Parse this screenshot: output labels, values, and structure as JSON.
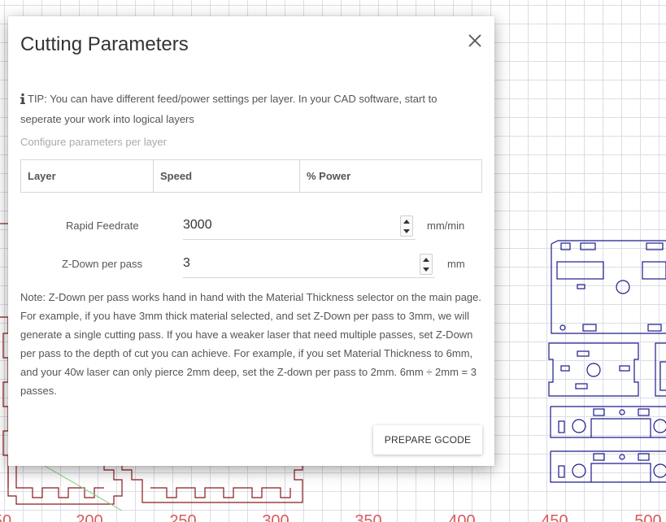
{
  "canvas": {
    "axis_labels": [
      "50",
      "200",
      "250",
      "300",
      "350",
      "400",
      "450",
      "500"
    ],
    "grid_color": "#dcdde6",
    "axis_label_color": "#d95b5b",
    "part_outline_red": "#8b1a1a",
    "part_outline_blue": "#1c1c8c"
  },
  "modal": {
    "title": "Cutting Parameters",
    "close_icon": "close-icon",
    "tip_icon": "info-icon",
    "tip_text": "TIP: You can have different feed/power settings per layer. In your CAD software, start to seperate your work into logical layers",
    "configure_text": "Configure parameters per layer",
    "table_headers": [
      "Layer",
      "Speed",
      "% Power"
    ],
    "rapid_feedrate": {
      "label": "Rapid Feedrate",
      "value": "3000",
      "unit": "mm/min"
    },
    "zdown": {
      "label": "Z-Down per pass",
      "value": "3",
      "unit": "mm"
    },
    "note": "Note: Z-Down per pass works hand in hand with the Material Thickness selector on the main page. For example, if you have 3mm thick material selected, and set Z-Down per pass to 3mm, we will generate a single cutting pass. If you have a weaker laser that need multiple passes, set Z-Down per pass to the depth of cut you can achieve. For example, if you set Material Thickness to 6mm, and your 40w laser can only pierce 2mm deep, set the Z-down per pass to 2mm. 6mm ÷ 2mm = 3 passes.",
    "prepare_button": "PREPARE GCODE"
  }
}
